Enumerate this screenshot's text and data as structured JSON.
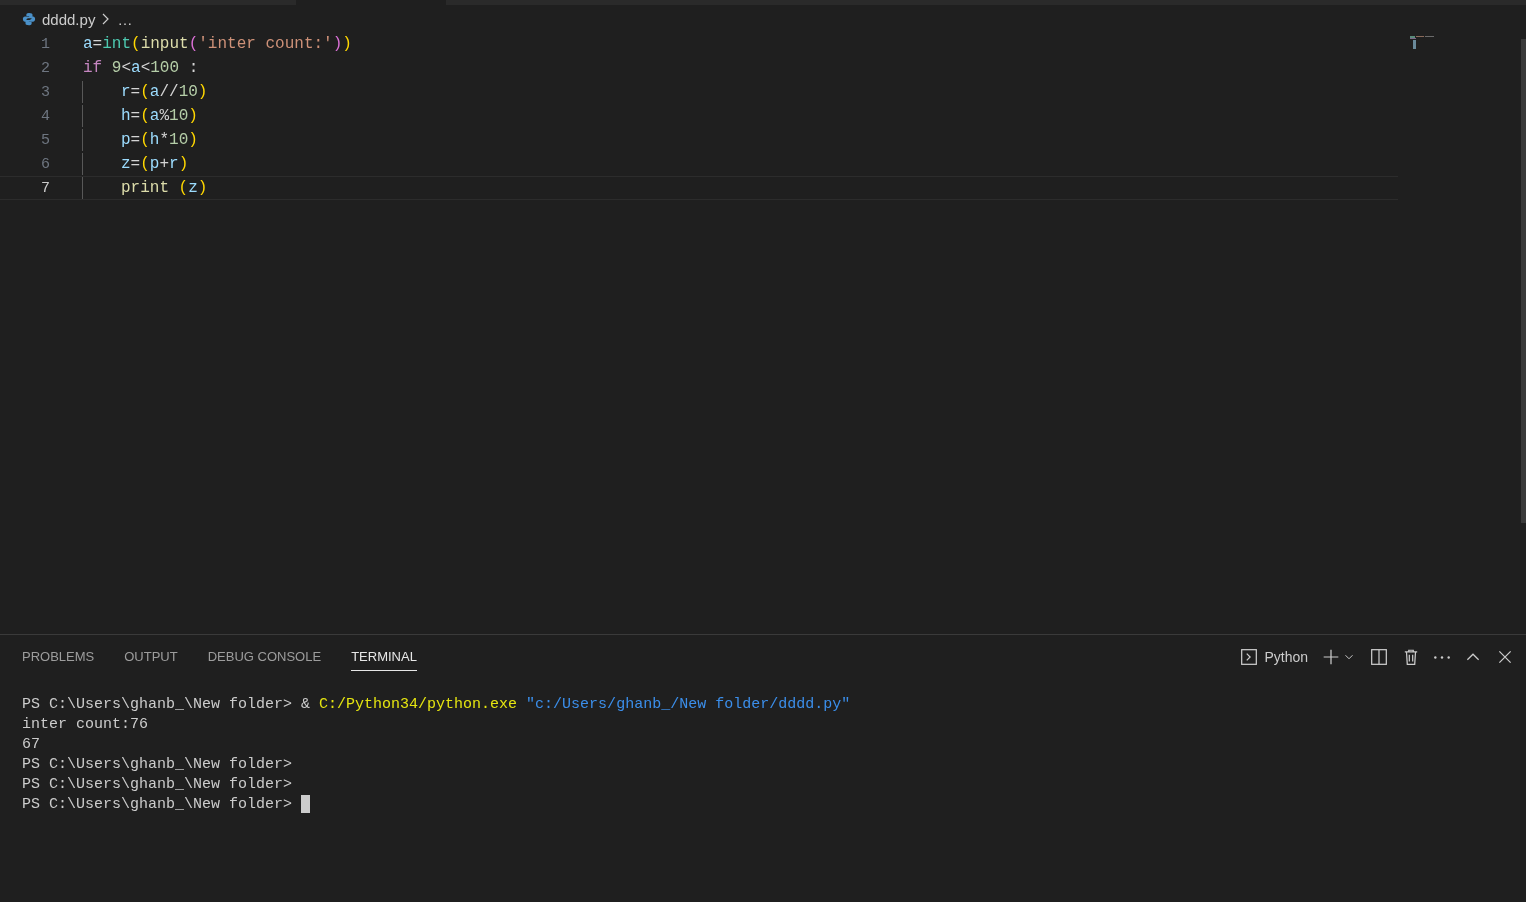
{
  "breadcrumb": {
    "file": "dddd.py",
    "separator": "…"
  },
  "editor": {
    "lines": [
      {
        "number": "1",
        "current": false,
        "indented": false,
        "tokens": [
          {
            "kind": "var",
            "text": "a"
          },
          {
            "kind": "op",
            "text": "="
          },
          {
            "kind": "type",
            "text": "int"
          },
          {
            "kind": "bracket1",
            "text": "("
          },
          {
            "kind": "func",
            "text": "input"
          },
          {
            "kind": "bracket2",
            "text": "("
          },
          {
            "kind": "string",
            "text": "'inter count:'"
          },
          {
            "kind": "bracket2",
            "text": ")"
          },
          {
            "kind": "bracket1",
            "text": ")"
          }
        ]
      },
      {
        "number": "2",
        "current": false,
        "indented": false,
        "tokens": [
          {
            "kind": "keyword",
            "text": "if "
          },
          {
            "kind": "number",
            "text": "9"
          },
          {
            "kind": "op",
            "text": "<"
          },
          {
            "kind": "var",
            "text": "a"
          },
          {
            "kind": "op",
            "text": "<"
          },
          {
            "kind": "number",
            "text": "100"
          },
          {
            "kind": "op",
            "text": " :"
          }
        ]
      },
      {
        "number": "3",
        "current": false,
        "indented": true,
        "tokens": [
          {
            "kind": "var",
            "text": "r"
          },
          {
            "kind": "op",
            "text": "="
          },
          {
            "kind": "bracket1",
            "text": "("
          },
          {
            "kind": "var",
            "text": "a"
          },
          {
            "kind": "op",
            "text": "//"
          },
          {
            "kind": "number",
            "text": "10"
          },
          {
            "kind": "bracket1",
            "text": ")"
          }
        ]
      },
      {
        "number": "4",
        "current": false,
        "indented": true,
        "tokens": [
          {
            "kind": "var",
            "text": "h"
          },
          {
            "kind": "op",
            "text": "="
          },
          {
            "kind": "bracket1",
            "text": "("
          },
          {
            "kind": "var",
            "text": "a"
          },
          {
            "kind": "op",
            "text": "%"
          },
          {
            "kind": "number",
            "text": "10"
          },
          {
            "kind": "bracket1",
            "text": ")"
          }
        ]
      },
      {
        "number": "5",
        "current": false,
        "indented": true,
        "tokens": [
          {
            "kind": "var",
            "text": "p"
          },
          {
            "kind": "op",
            "text": "="
          },
          {
            "kind": "bracket1",
            "text": "("
          },
          {
            "kind": "var",
            "text": "h"
          },
          {
            "kind": "op",
            "text": "*"
          },
          {
            "kind": "number",
            "text": "10"
          },
          {
            "kind": "bracket1",
            "text": ")"
          }
        ]
      },
      {
        "number": "6",
        "current": false,
        "indented": true,
        "tokens": [
          {
            "kind": "var",
            "text": "z"
          },
          {
            "kind": "op",
            "text": "="
          },
          {
            "kind": "bracket1",
            "text": "("
          },
          {
            "kind": "var",
            "text": "p"
          },
          {
            "kind": "op",
            "text": "+"
          },
          {
            "kind": "var",
            "text": "r"
          },
          {
            "kind": "bracket1",
            "text": ")"
          }
        ]
      },
      {
        "number": "7",
        "current": true,
        "indented": true,
        "tokens": [
          {
            "kind": "func",
            "text": "print "
          },
          {
            "kind": "bracket1",
            "text": "("
          },
          {
            "kind": "var",
            "text": "z"
          },
          {
            "kind": "bracket1",
            "text": ")"
          }
        ]
      }
    ]
  },
  "panel": {
    "tabs": [
      {
        "label": "PROBLEMS",
        "selected": false
      },
      {
        "label": "OUTPUT",
        "selected": false
      },
      {
        "label": "DEBUG CONSOLE",
        "selected": false
      },
      {
        "label": "TERMINAL",
        "selected": true
      }
    ],
    "terminal_name": "Python",
    "terminal": [
      {
        "segments": [
          {
            "kind": "plain",
            "text": "PS C:\\Users\\ghanb_\\New folder> & "
          },
          {
            "kind": "command",
            "text": "C:/Python34/python.exe"
          },
          {
            "kind": "string",
            "text": " \"c:/Users/ghanb_/New folder/dddd.py\""
          }
        ]
      },
      {
        "segments": [
          {
            "kind": "plain",
            "text": "inter count:76"
          }
        ]
      },
      {
        "segments": [
          {
            "kind": "plain",
            "text": "67"
          }
        ]
      },
      {
        "segments": [
          {
            "kind": "plain",
            "text": "PS C:\\Users\\ghanb_\\New folder>"
          }
        ]
      },
      {
        "segments": [
          {
            "kind": "plain",
            "text": "PS C:\\Users\\ghanb_\\New folder>"
          }
        ]
      },
      {
        "segments": [
          {
            "kind": "plain",
            "text": "PS C:\\Users\\ghanb_\\New folder> "
          }
        ],
        "cursor": true
      }
    ]
  }
}
